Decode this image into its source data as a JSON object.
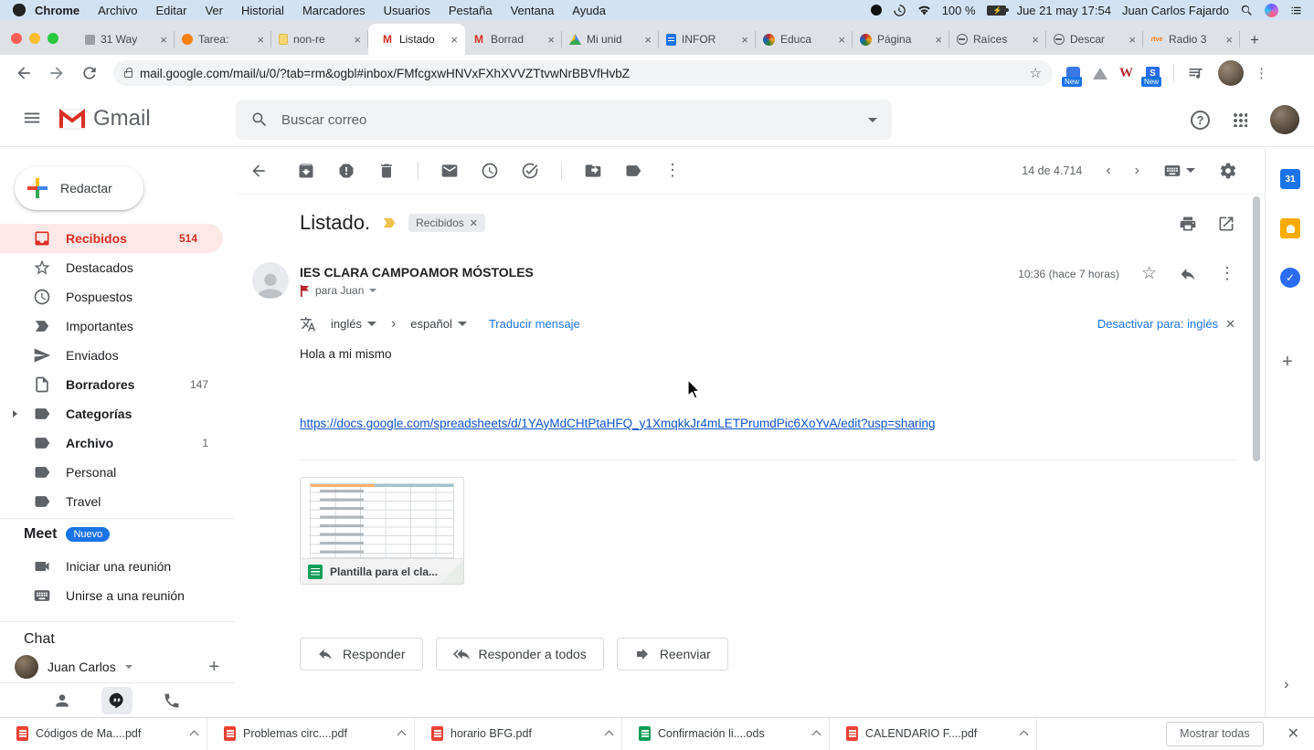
{
  "menubar": {
    "items": [
      "Chrome",
      "Archivo",
      "Editar",
      "Ver",
      "Historial",
      "Marcadores",
      "Usuarios",
      "Pestaña",
      "Ventana",
      "Ayuda"
    ],
    "battery": "100 %",
    "datetime": "Jue 21 may 17:54",
    "user": "Juan Carlos Fajardo"
  },
  "tabs": [
    {
      "label": "31 Way",
      "icon": "page-icon"
    },
    {
      "label": "Tarea: ",
      "icon": "moodle-icon"
    },
    {
      "label": "non-re",
      "icon": "note-icon"
    },
    {
      "label": "Listado",
      "icon": "gmail-icon"
    },
    {
      "label": "Borrad",
      "icon": "gmail-icon"
    },
    {
      "label": "Mi unid",
      "icon": "drive-icon"
    },
    {
      "label": "INFOR",
      "icon": "docs-icon"
    },
    {
      "label": "Educa",
      "icon": "educamadrid-icon"
    },
    {
      "label": "Página",
      "icon": "educamadrid-icon"
    },
    {
      "label": "Raíces",
      "icon": "globe-icon"
    },
    {
      "label": "Descar",
      "icon": "globe-icon"
    },
    {
      "label": "Radio 3",
      "icon": "rtve-icon"
    }
  ],
  "browser": {
    "url": "mail.google.com/mail/u/0/?tab=rm&ogbl#inbox/FMfcgxwHNVxFXhXVVZTtvwNrBBVfHvbZ",
    "ext_badge": "New"
  },
  "gmail": {
    "logo": "Gmail",
    "search_placeholder": "Buscar correo",
    "pagination": "14 de 4.714"
  },
  "sidebar": {
    "compose": "Redactar",
    "items": [
      {
        "label": "Recibidos",
        "count": "514"
      },
      {
        "label": "Destacados"
      },
      {
        "label": "Pospuestos"
      },
      {
        "label": "Importantes"
      },
      {
        "label": "Enviados"
      },
      {
        "label": "Borradores",
        "count": "147"
      },
      {
        "label": "Categorías"
      },
      {
        "label": "Archivo",
        "count": "1"
      },
      {
        "label": "Personal"
      },
      {
        "label": "Travel"
      }
    ],
    "meet_title": "Meet",
    "meet_badge": "Nuevo",
    "meet_item_1": "Iniciar una reunión",
    "meet_item_2": "Unirse a una reunión",
    "chat_title": "Chat",
    "chat_user": "Juan Carlos"
  },
  "message": {
    "subject": "Listado.",
    "label_chip": "Recibidos",
    "sender": "IES CLARA CAMPOAMOR MÓSTOLES",
    "recipient": "para Juan",
    "time": "10:36 (hace 7 horas)",
    "translate_from": "inglés",
    "translate_to": "español",
    "translate_action": "Traducir mensaje",
    "translate_dismiss": "Desactivar para: inglés",
    "body": "Hola a mi mismo",
    "link": "https://docs.google.com/spreadsheets/d/1YAyMdCHtPtaHFQ_y1XmqkkJr4mLETPrumdPic6XoYvA/edit?usp=sharing",
    "attachment_name": "Plantilla para el cla...",
    "reply": "Responder",
    "reply_all": "Responder a todos",
    "forward": "Reenviar"
  },
  "downloads": {
    "items": [
      {
        "name": "Códigos de Ma....pdf",
        "type": "pdf"
      },
      {
        "name": "Problemas circ....pdf",
        "type": "pdf"
      },
      {
        "name": "horario BFG.pdf",
        "type": "pdf"
      },
      {
        "name": "Confirmación li....ods",
        "type": "ods"
      },
      {
        "name": "CALENDARIO F....pdf",
        "type": "pdf"
      }
    ],
    "show_all": "Mostrar todas"
  },
  "colors": {
    "gmail_red": "#d93025",
    "accent_blue": "#1a73e8",
    "link_blue": "#1155cc",
    "active_item_bg": "#fce8e6",
    "pdf_red": "#e94235",
    "ods_green": "#0f9d58"
  }
}
